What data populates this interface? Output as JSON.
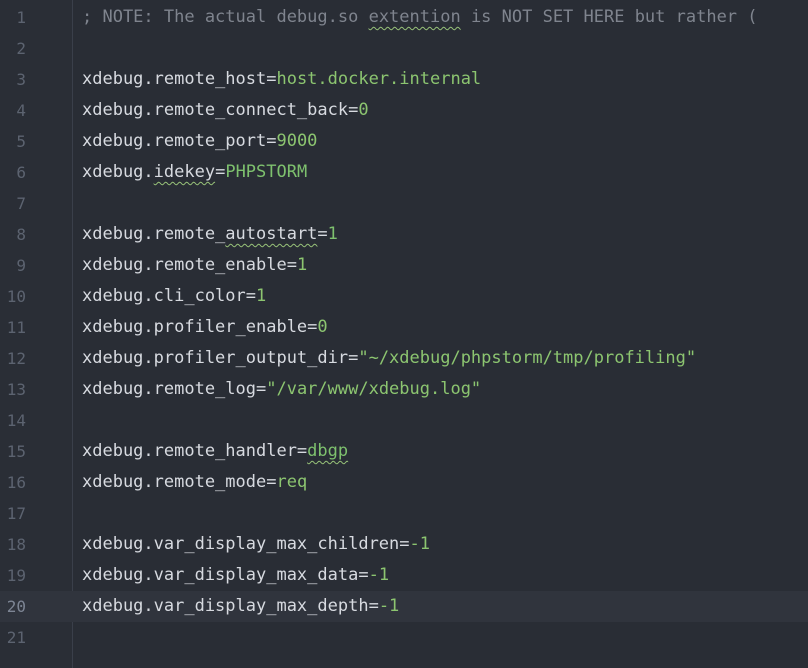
{
  "lines": [
    {
      "n": "1",
      "key": "; NOTE: The actual debug.so ",
      "sq": "extention",
      "rest": " is NOT SET HERE but rather ("
    },
    {
      "n": "2"
    },
    {
      "n": "3",
      "key": "xdebug.remote_host=",
      "val": "host.docker.internal"
    },
    {
      "n": "4",
      "key": "xdebug.remote_connect_back=",
      "val": "0"
    },
    {
      "n": "5",
      "key": "xdebug.remote_port=",
      "val": "9000"
    },
    {
      "n": "6",
      "pre": "xdebug.",
      "sq": "idekey",
      "key": "=",
      "val": "PHPSTORM"
    },
    {
      "n": "7"
    },
    {
      "n": "8",
      "pre": "xdebug.remote_",
      "sq": "autostart",
      "key": "=",
      "val": "1"
    },
    {
      "n": "9",
      "key": "xdebug.remote_enable=",
      "val": "1"
    },
    {
      "n": "10",
      "key": "xdebug.cli_color=",
      "val": "1"
    },
    {
      "n": "11",
      "key": "xdebug.profiler_enable=",
      "val": "0"
    },
    {
      "n": "12",
      "key": "xdebug.profiler_output_dir=",
      "val": "\"~/xdebug/phpstorm/tmp/profiling\""
    },
    {
      "n": "13",
      "key": "xdebug.remote_log=",
      "val": "\"/var/www/xdebug.log\""
    },
    {
      "n": "14"
    },
    {
      "n": "15",
      "key": "xdebug.remote_handler=",
      "valsq": "dbgp"
    },
    {
      "n": "16",
      "key": "xdebug.remote_mode=",
      "val": "req"
    },
    {
      "n": "17"
    },
    {
      "n": "18",
      "key": "xdebug.var_display_max_children=",
      "val": "-1"
    },
    {
      "n": "19",
      "key": "xdebug.var_display_max_data=",
      "val": "-1"
    },
    {
      "n": "20",
      "key": "xdebug.var_display_max_depth=",
      "val": "-1",
      "current": true
    },
    {
      "n": "21"
    }
  ]
}
